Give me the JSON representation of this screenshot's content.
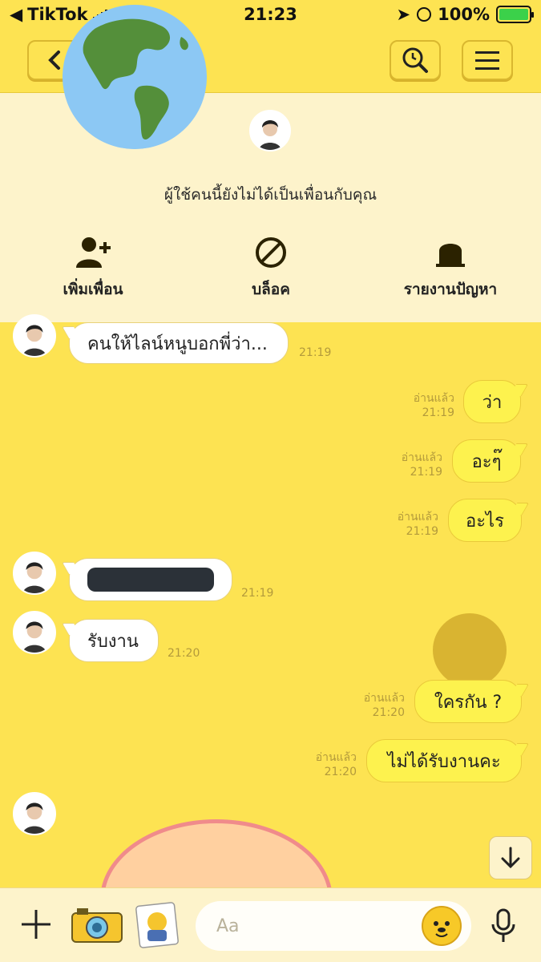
{
  "status_bar": {
    "carrier": "TikTok",
    "time": "21:23",
    "battery": "100%"
  },
  "banner": {
    "message": "ผู้ใช้คนนี้ยังไม่ได้เป็นเพื่อนกับคุณ",
    "actions": [
      {
        "label": "เพิ่มเพื่อน",
        "icon": "add-friend-icon"
      },
      {
        "label": "บล็อค",
        "icon": "block-icon"
      },
      {
        "label": "รายงานปัญหา",
        "icon": "report-icon"
      }
    ]
  },
  "messages": [
    {
      "side": "in",
      "text": "คนให้ไลน์หนูบอกพี่ว่า...",
      "time": "21:19"
    },
    {
      "side": "out",
      "text": "ว่า",
      "status": "อ่านแล้ว",
      "time": "21:19"
    },
    {
      "side": "out",
      "text": "อะๆ๊",
      "status": "อ่านแล้ว",
      "time": "21:19"
    },
    {
      "side": "out",
      "text": "อะไร",
      "status": "อ่านแล้ว",
      "time": "21:19"
    },
    {
      "side": "in",
      "text": "",
      "time": "21:19",
      "redacted": true
    },
    {
      "side": "in",
      "text": "รับงาน",
      "time": "21:20"
    },
    {
      "side": "out",
      "text": "ใครกัน ?",
      "status": "อ่านแล้ว",
      "time": "21:20"
    },
    {
      "side": "out",
      "text": "ไม่ได้รับงานคะ",
      "status": "อ่านแล้ว",
      "time": "21:20"
    }
  ],
  "input": {
    "placeholder": "Aa"
  },
  "colors": {
    "background": "#fde352",
    "banner": "#fdf3cb",
    "bubble_out": "#fdf24e",
    "bubble_in": "#ffffff"
  }
}
